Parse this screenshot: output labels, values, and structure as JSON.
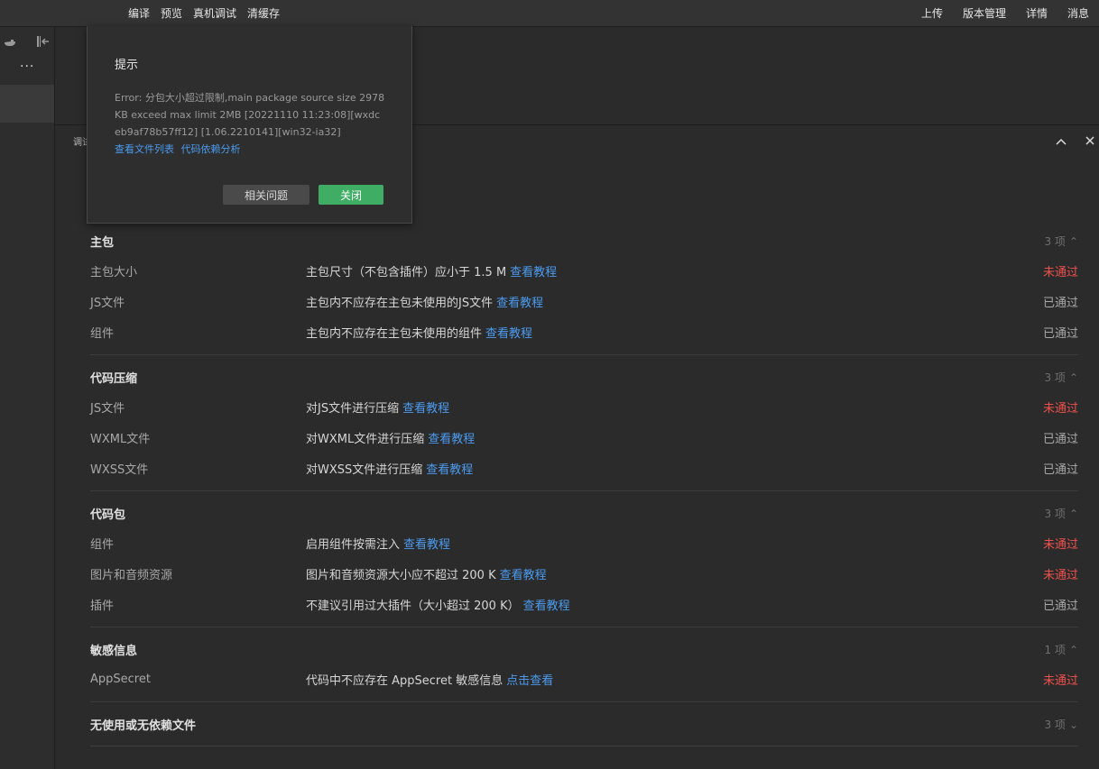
{
  "toolbar": {
    "left": [
      "编译",
      "预览",
      "真机调试",
      "清缓存"
    ],
    "right": [
      "上传",
      "版本管理",
      "详情",
      "消息"
    ]
  },
  "sidebar": {
    "more": "···"
  },
  "panel": {
    "title": "调试",
    "collapse_icon": "chevron-up",
    "close_icon": "close"
  },
  "sections": [
    {
      "title": "主包",
      "count": "3 项",
      "chevron": "⌃",
      "rows": [
        {
          "name": "主包大小",
          "desc": "主包尺寸（不包含插件）应小于 1.5 M",
          "link": "查看教程",
          "status": "未通过",
          "fail": true
        },
        {
          "name": "JS文件",
          "desc": "主包内不应存在主包未使用的JS文件",
          "link": "查看教程",
          "status": "已通过",
          "fail": false
        },
        {
          "name": "组件",
          "desc": "主包内不应存在主包未使用的组件",
          "link": "查看教程",
          "status": "已通过",
          "fail": false
        }
      ]
    },
    {
      "title": "代码压缩",
      "count": "3 项",
      "chevron": "⌃",
      "rows": [
        {
          "name": "JS文件",
          "desc": "对JS文件进行压缩",
          "link": "查看教程",
          "status": "未通过",
          "fail": true
        },
        {
          "name": "WXML文件",
          "desc": "对WXML文件进行压缩",
          "link": "查看教程",
          "status": "已通过",
          "fail": false
        },
        {
          "name": "WXSS文件",
          "desc": "对WXSS文件进行压缩",
          "link": "查看教程",
          "status": "已通过",
          "fail": false
        }
      ]
    },
    {
      "title": "代码包",
      "count": "3 项",
      "chevron": "⌃",
      "rows": [
        {
          "name": "组件",
          "desc": "启用组件按需注入",
          "link": "查看教程",
          "status": "未通过",
          "fail": true
        },
        {
          "name": "图片和音频资源",
          "desc": "图片和音频资源大小应不超过 200 K",
          "link": "查看教程",
          "status": "未通过",
          "fail": true
        },
        {
          "name": "插件",
          "desc": "不建议引用过大插件（大小超过 200 K）",
          "link": "查看教程",
          "status": "已通过",
          "fail": false
        }
      ]
    },
    {
      "title": "敏感信息",
      "count": "1 项",
      "chevron": "⌃",
      "rows": [
        {
          "name": "AppSecret",
          "desc": "代码中不应存在 AppSecret 敏感信息",
          "link": "点击查看",
          "status": "未通过",
          "fail": true
        }
      ]
    },
    {
      "title": "无使用或无依赖文件",
      "count": "3 项",
      "chevron": "⌄",
      "rows": []
    }
  ],
  "dialog": {
    "title": "提示",
    "message": "Error: 分包大小超过限制,main package source size 2978KB exceed max limit 2MB [20221110 11:23:08][wxdceb9af78b57ff12] [1.06.2210141][win32-ia32]",
    "links": [
      "查看文件列表",
      "代码依赖分析"
    ],
    "btn_related": "相关问题",
    "btn_close": "关闭"
  },
  "colors": {
    "fail": "#f0504c",
    "link": "#4c9bef",
    "primary": "#3fae64"
  }
}
